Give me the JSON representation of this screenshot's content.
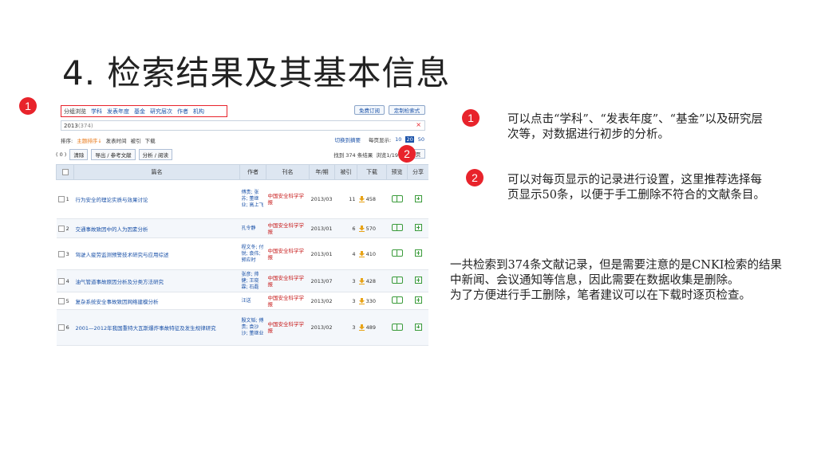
{
  "slide": {
    "title": "4. 检索结果及其基本信息",
    "marker_main": "1"
  },
  "ui": {
    "filter_bar": [
      "分组浏览",
      "学科",
      "发表年度",
      "基金",
      "研究层次",
      "作者",
      "机构"
    ],
    "btn_subscribe": "免费订阅",
    "btn_custom": "定制检索式",
    "query": "2013",
    "query_count": "(374)",
    "query_clear": "×",
    "sort_label": "排序:",
    "sort_active": "主题排序↓",
    "sort_options": [
      "发表时间",
      "被引",
      "下载"
    ],
    "switch_label": "切换到摘要",
    "per_page_label": "每页显示:",
    "per_page_options": [
      "10",
      "20",
      "50"
    ],
    "per_page_selected": "20",
    "action_prefix": "( 0 )",
    "action_clear": "清除",
    "action_export": "导出 / 参考文献",
    "action_analyze": "分析 / 阅读",
    "found_text": "找到 374 条结果",
    "browse_text": "浏览1/19",
    "next_page": "页",
    "marker_page": "2",
    "headers": [
      "",
      "篇名",
      "作者",
      "刊名",
      "年/期",
      "被引",
      "下载",
      "预览",
      "分享"
    ],
    "rows": [
      {
        "no": "1",
        "title": "行为安全的理论实质与效果讨论",
        "authors": "傅贵; 张苏; 董继业; 高上飞",
        "journal": "中国安全科学学报",
        "issue": "2013/03",
        "cited": "11",
        "downloads": "458"
      },
      {
        "no": "2",
        "title": "交通事故致因中的人为因素分析",
        "authors": "孔令静",
        "journal": "中国安全科学学报",
        "issue": "2013/01",
        "cited": "6",
        "downloads": "570"
      },
      {
        "no": "3",
        "title": "驾驶人疲劳监测预警技术研究与应用综述",
        "authors": "程文冬; 付锐; 袁伟; 郭应时",
        "journal": "中国安全科学学报",
        "issue": "2013/01",
        "cited": "4",
        "downloads": "410"
      },
      {
        "no": "4",
        "title": "油气管道事故原因分析及分类方法研究",
        "authors": "张彦; 帅健; 王晓霖; 石磊",
        "journal": "中国安全科学学报",
        "issue": "2013/07",
        "cited": "3",
        "downloads": "428"
      },
      {
        "no": "5",
        "title": "复杂系统安全事故致因网络建模分析",
        "authors": "汪送",
        "journal": "中国安全科学学报",
        "issue": "2013/02",
        "cited": "3",
        "downloads": "330"
      },
      {
        "no": "6",
        "title": "2001—2012年我国重特大瓦斯爆炸事故特征及发生规律研究",
        "authors": "殷文韬; 傅贵; 袁沙沙; 董继业",
        "journal": "中国安全科学学报",
        "issue": "2013/02",
        "cited": "3",
        "downloads": "489"
      }
    ]
  },
  "notes": {
    "marker1": "1",
    "note1": "可以点击“学科”、“发表年度”、“基金”以及研究层次等，对数据进行初步的分析。",
    "marker2": "2",
    "note2": "可以对每页显示的记录进行设置，这里推荐选择每页显示50条，以便于手工删除不符合的文献条目。",
    "note3_p1": "一共检索到374条文献记录，但是需要注意的是CNKI检索的结果中新闻、会议通知等信息，因此需要在数据收集是删除。",
    "note3_p2": "为了方便进行手工删除，笔者建议可以在下载时逐页检查。"
  },
  "colors": {
    "marker_red": "#e8232b",
    "link_blue": "#1b52a8",
    "journal_red": "#c81e1e",
    "header_bg": "#dde6f1",
    "icon_green": "#3a9b3a",
    "download_orange": "#e8a317"
  }
}
